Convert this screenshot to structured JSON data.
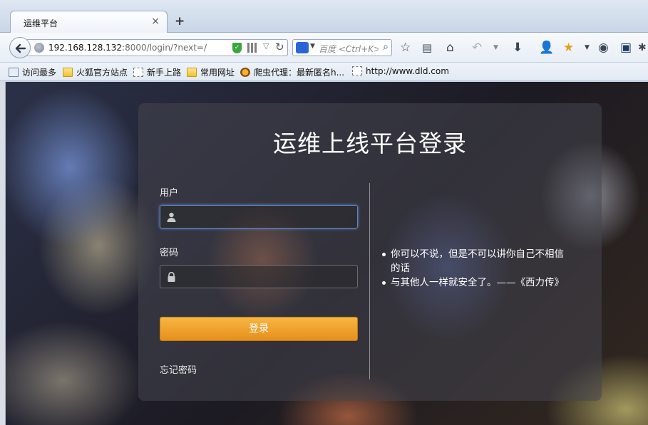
{
  "browser": {
    "tab": {
      "title": "运维平台",
      "close_glyph": "×"
    },
    "new_tab_glyph": "+",
    "url": {
      "host": "192.168.128.132",
      "rest": ":8000/login/?next=/"
    },
    "search": {
      "engine_icon": "baidu-icon",
      "placeholder": "百度 <Ctrl+K>"
    },
    "toolbar_icons": [
      "star-icon",
      "reader-icon",
      "home-icon",
      "undo-icon",
      "dropdown-icon",
      "download-icon",
      "user-icon",
      "extension-star-icon",
      "dropdown-icon",
      "avatar-icon",
      "profile-icon",
      "bee-icon"
    ],
    "bookmarks": [
      {
        "label": "访问最多",
        "icon": "page"
      },
      {
        "label": "火狐官方站点",
        "icon": "folder"
      },
      {
        "label": "新手上路",
        "icon": "dotted"
      },
      {
        "label": "常用网址",
        "icon": "folder"
      },
      {
        "label": "爬虫代理：最新匿名h...",
        "icon": "bee"
      },
      {
        "label": "http://www.dld.com",
        "icon": "dotted"
      }
    ]
  },
  "login": {
    "title": "运维上线平台登录",
    "user_label": "用户",
    "user_value": "",
    "password_label": "密码",
    "password_value": "",
    "submit_label": "登录",
    "forgot_label": "忘记密码",
    "quotes": [
      "你可以不说，但是不可以讲你自己不相信的话",
      "与其他人一样就安全了。——《西力传》"
    ]
  },
  "colors": {
    "accent_button": "#f0a030",
    "focus_ring": "#5e86c2"
  }
}
